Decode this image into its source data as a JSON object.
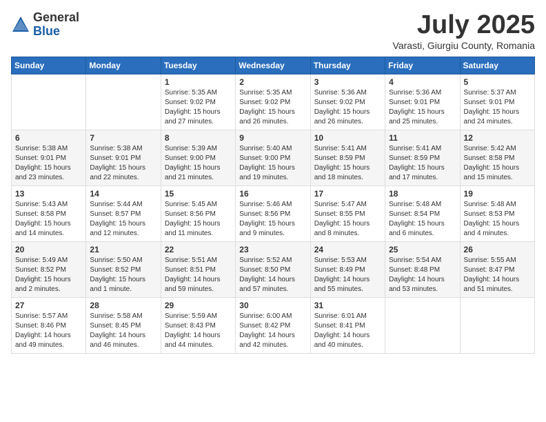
{
  "header": {
    "logo_general": "General",
    "logo_blue": "Blue",
    "month_title": "July 2025",
    "location": "Varasti, Giurgiu County, Romania"
  },
  "weekdays": [
    "Sunday",
    "Monday",
    "Tuesday",
    "Wednesday",
    "Thursday",
    "Friday",
    "Saturday"
  ],
  "weeks": [
    [
      {
        "day": "",
        "info": ""
      },
      {
        "day": "",
        "info": ""
      },
      {
        "day": "1",
        "info": "Sunrise: 5:35 AM\nSunset: 9:02 PM\nDaylight: 15 hours and 27 minutes."
      },
      {
        "day": "2",
        "info": "Sunrise: 5:35 AM\nSunset: 9:02 PM\nDaylight: 15 hours and 26 minutes."
      },
      {
        "day": "3",
        "info": "Sunrise: 5:36 AM\nSunset: 9:02 PM\nDaylight: 15 hours and 26 minutes."
      },
      {
        "day": "4",
        "info": "Sunrise: 5:36 AM\nSunset: 9:01 PM\nDaylight: 15 hours and 25 minutes."
      },
      {
        "day": "5",
        "info": "Sunrise: 5:37 AM\nSunset: 9:01 PM\nDaylight: 15 hours and 24 minutes."
      }
    ],
    [
      {
        "day": "6",
        "info": "Sunrise: 5:38 AM\nSunset: 9:01 PM\nDaylight: 15 hours and 23 minutes."
      },
      {
        "day": "7",
        "info": "Sunrise: 5:38 AM\nSunset: 9:01 PM\nDaylight: 15 hours and 22 minutes."
      },
      {
        "day": "8",
        "info": "Sunrise: 5:39 AM\nSunset: 9:00 PM\nDaylight: 15 hours and 21 minutes."
      },
      {
        "day": "9",
        "info": "Sunrise: 5:40 AM\nSunset: 9:00 PM\nDaylight: 15 hours and 19 minutes."
      },
      {
        "day": "10",
        "info": "Sunrise: 5:41 AM\nSunset: 8:59 PM\nDaylight: 15 hours and 18 minutes."
      },
      {
        "day": "11",
        "info": "Sunrise: 5:41 AM\nSunset: 8:59 PM\nDaylight: 15 hours and 17 minutes."
      },
      {
        "day": "12",
        "info": "Sunrise: 5:42 AM\nSunset: 8:58 PM\nDaylight: 15 hours and 15 minutes."
      }
    ],
    [
      {
        "day": "13",
        "info": "Sunrise: 5:43 AM\nSunset: 8:58 PM\nDaylight: 15 hours and 14 minutes."
      },
      {
        "day": "14",
        "info": "Sunrise: 5:44 AM\nSunset: 8:57 PM\nDaylight: 15 hours and 12 minutes."
      },
      {
        "day": "15",
        "info": "Sunrise: 5:45 AM\nSunset: 8:56 PM\nDaylight: 15 hours and 11 minutes."
      },
      {
        "day": "16",
        "info": "Sunrise: 5:46 AM\nSunset: 8:56 PM\nDaylight: 15 hours and 9 minutes."
      },
      {
        "day": "17",
        "info": "Sunrise: 5:47 AM\nSunset: 8:55 PM\nDaylight: 15 hours and 8 minutes."
      },
      {
        "day": "18",
        "info": "Sunrise: 5:48 AM\nSunset: 8:54 PM\nDaylight: 15 hours and 6 minutes."
      },
      {
        "day": "19",
        "info": "Sunrise: 5:48 AM\nSunset: 8:53 PM\nDaylight: 15 hours and 4 minutes."
      }
    ],
    [
      {
        "day": "20",
        "info": "Sunrise: 5:49 AM\nSunset: 8:52 PM\nDaylight: 15 hours and 2 minutes."
      },
      {
        "day": "21",
        "info": "Sunrise: 5:50 AM\nSunset: 8:52 PM\nDaylight: 15 hours and 1 minute."
      },
      {
        "day": "22",
        "info": "Sunrise: 5:51 AM\nSunset: 8:51 PM\nDaylight: 14 hours and 59 minutes."
      },
      {
        "day": "23",
        "info": "Sunrise: 5:52 AM\nSunset: 8:50 PM\nDaylight: 14 hours and 57 minutes."
      },
      {
        "day": "24",
        "info": "Sunrise: 5:53 AM\nSunset: 8:49 PM\nDaylight: 14 hours and 55 minutes."
      },
      {
        "day": "25",
        "info": "Sunrise: 5:54 AM\nSunset: 8:48 PM\nDaylight: 14 hours and 53 minutes."
      },
      {
        "day": "26",
        "info": "Sunrise: 5:55 AM\nSunset: 8:47 PM\nDaylight: 14 hours and 51 minutes."
      }
    ],
    [
      {
        "day": "27",
        "info": "Sunrise: 5:57 AM\nSunset: 8:46 PM\nDaylight: 14 hours and 49 minutes."
      },
      {
        "day": "28",
        "info": "Sunrise: 5:58 AM\nSunset: 8:45 PM\nDaylight: 14 hours and 46 minutes."
      },
      {
        "day": "29",
        "info": "Sunrise: 5:59 AM\nSunset: 8:43 PM\nDaylight: 14 hours and 44 minutes."
      },
      {
        "day": "30",
        "info": "Sunrise: 6:00 AM\nSunset: 8:42 PM\nDaylight: 14 hours and 42 minutes."
      },
      {
        "day": "31",
        "info": "Sunrise: 6:01 AM\nSunset: 8:41 PM\nDaylight: 14 hours and 40 minutes."
      },
      {
        "day": "",
        "info": ""
      },
      {
        "day": "",
        "info": ""
      }
    ]
  ]
}
